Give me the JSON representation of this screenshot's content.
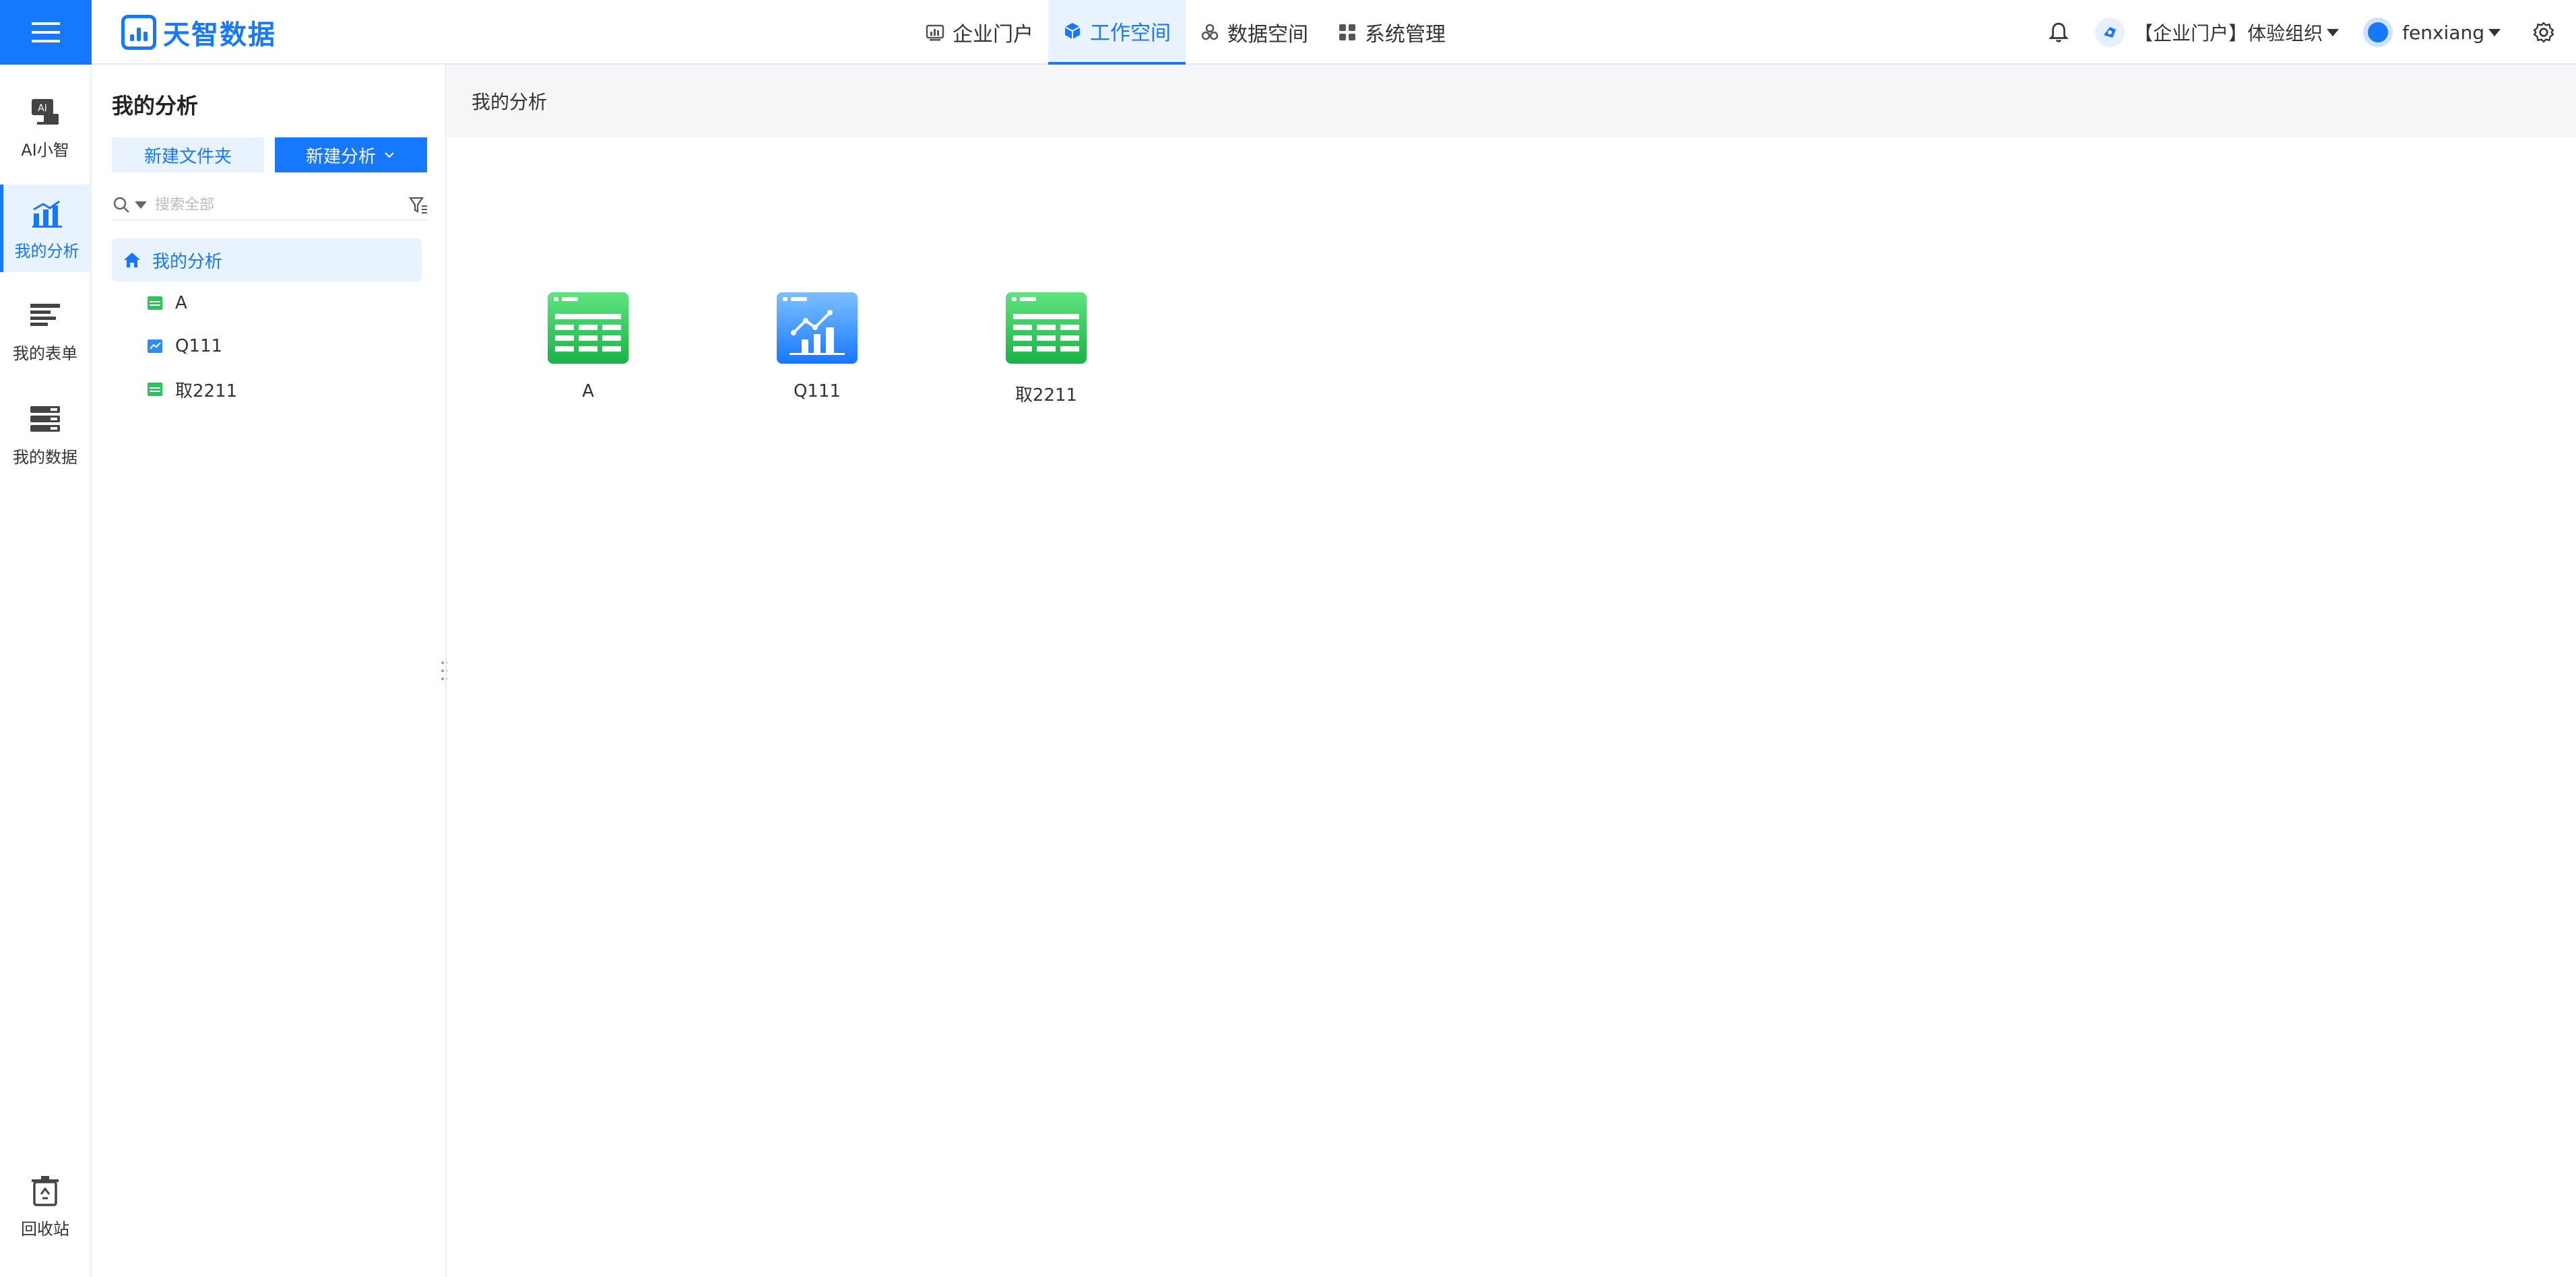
{
  "header": {
    "logo_text": "天智数据",
    "nav": [
      {
        "label": "企业门户",
        "icon": "chart-board-icon"
      },
      {
        "label": "工作空间",
        "icon": "cube-icon",
        "active": true
      },
      {
        "label": "数据空间",
        "icon": "data-cluster-icon"
      },
      {
        "label": "系统管理",
        "icon": "grid-icon"
      }
    ],
    "org_name": "【企业门户】体验组织",
    "user_name": "fenxiang"
  },
  "rail": {
    "items": [
      {
        "label": "AI小智",
        "icon": "ai-assistant-icon"
      },
      {
        "label": "我的分析",
        "icon": "analysis-chart-icon",
        "active": true
      },
      {
        "label": "我的表单",
        "icon": "form-icon"
      },
      {
        "label": "我的数据",
        "icon": "database-icon"
      }
    ],
    "recycle_label": "回收站"
  },
  "panel": {
    "title": "我的分析",
    "new_folder_label": "新建文件夹",
    "new_analysis_label": "新建分析",
    "search_placeholder": "搜索全部",
    "tree_root": "我的分析",
    "tree_items": [
      {
        "label": "A",
        "type": "table"
      },
      {
        "label": "Q111",
        "type": "dashboard"
      },
      {
        "label": "取2211",
        "type": "table"
      }
    ]
  },
  "content": {
    "breadcrumb": "我的分析",
    "cards": [
      {
        "label": "A",
        "type": "table"
      },
      {
        "label": "Q111",
        "type": "dashboard"
      },
      {
        "label": "取2211",
        "type": "table"
      }
    ]
  },
  "colors": {
    "accent": "#1677ff",
    "table_green": "#2fc25b",
    "dashboard_blue": "#2f8cf0",
    "active_bg": "#e8f3ff"
  }
}
